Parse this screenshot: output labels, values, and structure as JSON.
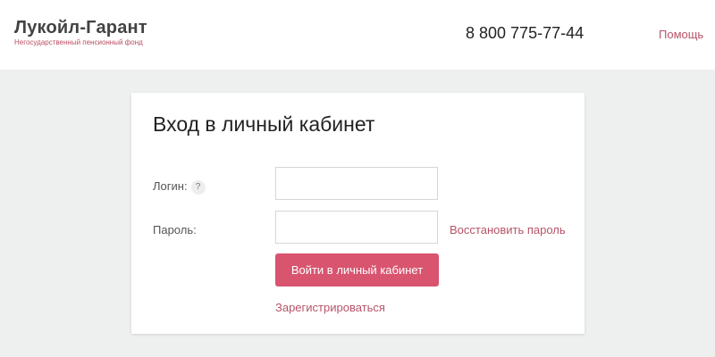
{
  "header": {
    "logo_title": "Лукойл-Гарант",
    "logo_subtitle": "Негосударственный пенсионный фонд",
    "phone": "8 800 775-77-44",
    "help_label": "Помощь"
  },
  "login_form": {
    "title": "Вход в личный кабинет",
    "login_label": "Логин:",
    "login_help_icon": "?",
    "login_value": "",
    "password_label": "Пароль:",
    "password_value": "",
    "restore_password_label": "Восстановить пароль",
    "submit_label": "Войти в личный кабинет",
    "register_label": "Зарегистрироваться"
  },
  "colors": {
    "accent": "#d8546f",
    "link": "#b75468",
    "page_background": "#eef0ef"
  }
}
